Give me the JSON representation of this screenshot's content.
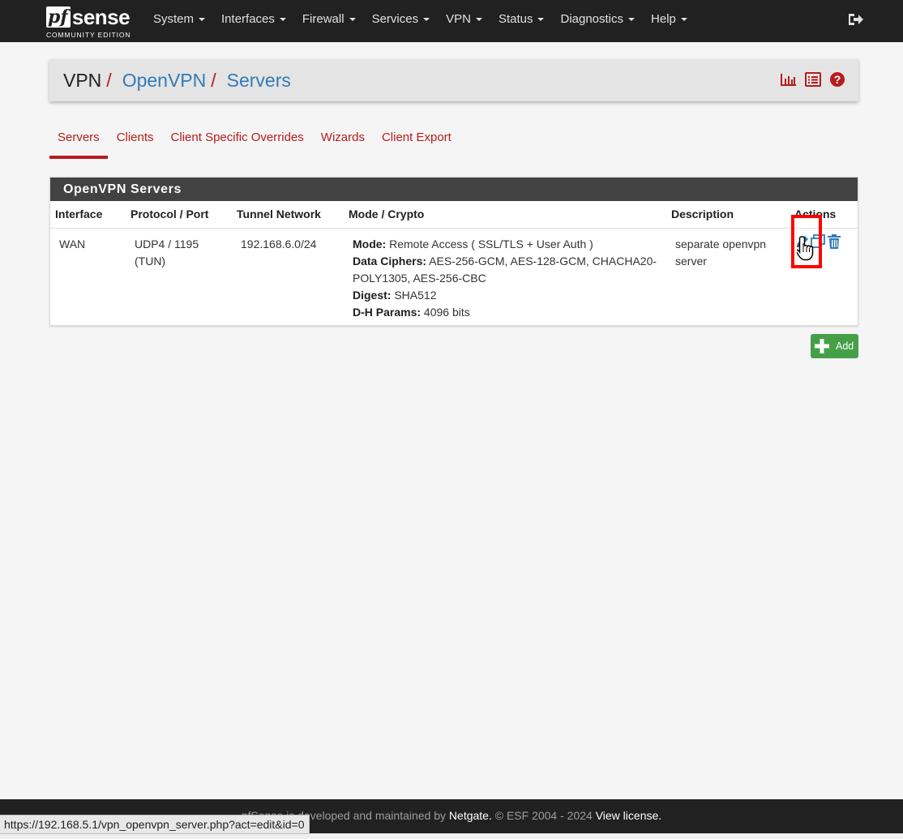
{
  "brand": {
    "logo_main": "sense",
    "logo_pf": "pf",
    "logo_sub": "COMMUNITY EDITION"
  },
  "nav": {
    "items": [
      "System",
      "Interfaces",
      "Firewall",
      "Services",
      "VPN",
      "Status",
      "Diagnostics",
      "Help"
    ],
    "logout_icon": "sign-out-icon"
  },
  "breadcrumb": {
    "level1": "VPN",
    "level2": "OpenVPN",
    "level3": "Servers",
    "separator": "/",
    "icons": [
      "chart-icon",
      "list-icon",
      "help-icon"
    ]
  },
  "tabs": {
    "items": [
      "Servers",
      "Clients",
      "Client Specific Overrides",
      "Wizards",
      "Client Export"
    ],
    "active": "Servers"
  },
  "panel": {
    "title": "OpenVPN Servers",
    "columns": [
      "Interface",
      "Protocol / Port",
      "Tunnel Network",
      "Mode / Crypto",
      "Description",
      "Actions"
    ],
    "rows": [
      {
        "interface": "WAN",
        "protocol_port": "UDP4 / 1195",
        "protocol_mode": "(TUN)",
        "tunnel_network": "192.168.6.0/24",
        "mode_label": "Mode:",
        "mode_value": "Remote Access ( SSL/TLS + User Auth )",
        "ciphers_label": "Data Ciphers:",
        "ciphers_value": "AES-256-GCM, AES-128-GCM, CHACHA20-POLY1305, AES-256-CBC",
        "digest_label": "Digest:",
        "digest_value": "SHA512",
        "dh_label": "D-H Params:",
        "dh_value": "4096 bits",
        "description": "separate openvpn server",
        "actions": [
          "edit-icon",
          "copy-icon",
          "trash-icon"
        ]
      }
    ]
  },
  "add_button": {
    "label": "Add"
  },
  "footer": {
    "part1": "pfSense",
    "part2": " is developed and maintained by ",
    "netgate": "Netgate.",
    "part3": " © ESF 2004 - 2024 ",
    "license": "View license."
  },
  "status_bar": {
    "url": "https://192.168.5.1/vpn_openvpn_server.php?act=edit&id=0"
  },
  "colors": {
    "navbar": "#212121",
    "accent_red": "#b71c1c",
    "link_blue": "#337ab7",
    "add_green": "#43a047",
    "highlight": "#ff0000"
  }
}
